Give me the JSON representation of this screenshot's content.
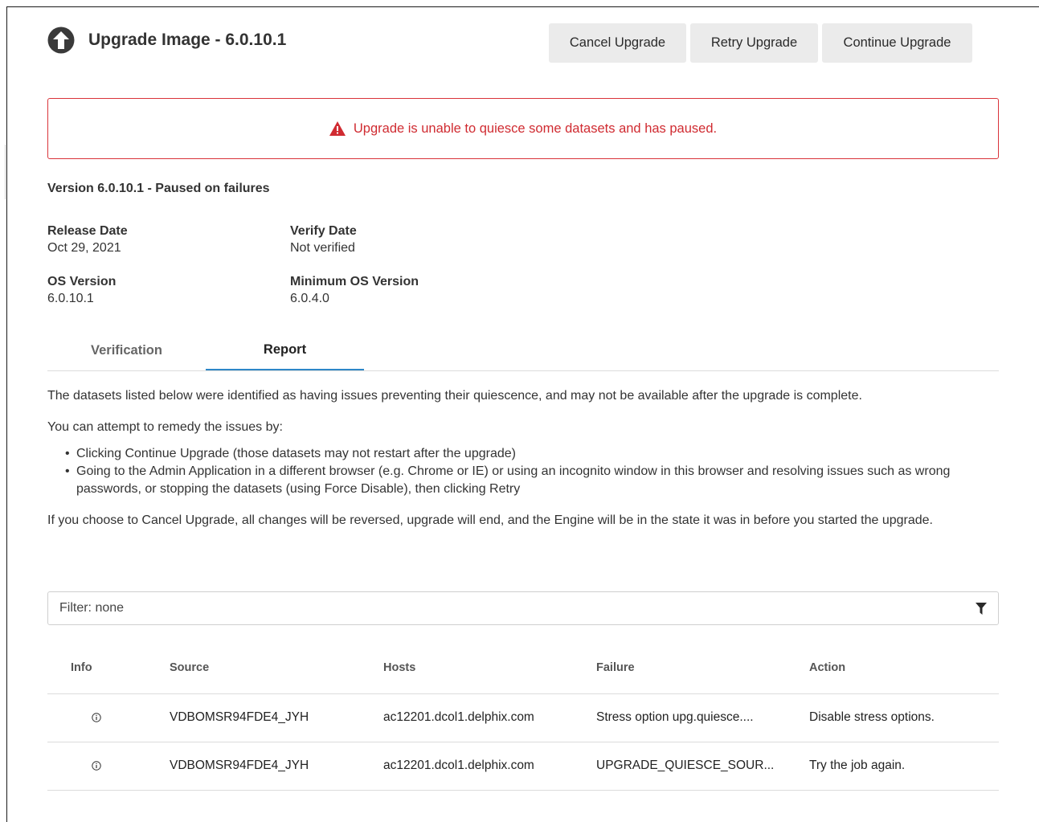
{
  "header": {
    "title": "Upgrade Image - 6.0.10.1",
    "icon": "upgrade-arrow-icon"
  },
  "buttons": {
    "cancel": "Cancel Upgrade",
    "retry": "Retry Upgrade",
    "continue": "Continue Upgrade"
  },
  "alert": {
    "message": "Upgrade is unable to quiesce some datasets and has paused.",
    "icon": "warning-icon",
    "color": "#d02b31"
  },
  "version_status": "Version 6.0.10.1 - Paused on failures",
  "details": {
    "release_date_label": "Release Date",
    "release_date": "Oct 29, 2021",
    "verify_date_label": "Verify Date",
    "verify_date": "Not verified",
    "os_version_label": "OS Version",
    "os_version": "6.0.10.1",
    "min_os_version_label": "Minimum OS Version",
    "min_os_version": "6.0.4.0"
  },
  "tabs": {
    "verification": "Verification",
    "report": "Report",
    "active": "Report",
    "accent": "#2d87c8"
  },
  "report": {
    "intro": "The datasets listed below were identified as having issues preventing their quiescence, and may not be available after the upgrade is complete.",
    "remedy_intro": "You can attempt to remedy the issues by:",
    "remedies": [
      "Clicking Continue Upgrade (those datasets may not restart after the upgrade)",
      "Going to the Admin Application in a different browser (e.g. Chrome or IE) or using an incognito window in this browser and resolving issues such as wrong passwords, or stopping the datasets (using Force Disable), then clicking Retry"
    ],
    "cancel_note": "If you choose to Cancel Upgrade, all changes will be reversed, upgrade will end, and the Engine will be in the state it was in before you started the upgrade."
  },
  "filter": {
    "text": "Filter: none",
    "icon": "funnel-icon"
  },
  "table": {
    "columns": [
      "Info",
      "Source",
      "Hosts",
      "Failure",
      "Action"
    ],
    "rows": [
      {
        "source": "VDBOMSR94FDE4_JYH",
        "hosts": "ac12201.dcol1.delphix.com",
        "failure": "Stress option upg.quiesce....",
        "action": "Disable stress options."
      },
      {
        "source": "VDBOMSR94FDE4_JYH",
        "hosts": "ac12201.dcol1.delphix.com",
        "failure": "UPGRADE_QUIESCE_SOUR...",
        "action": "Try the job again."
      }
    ]
  }
}
